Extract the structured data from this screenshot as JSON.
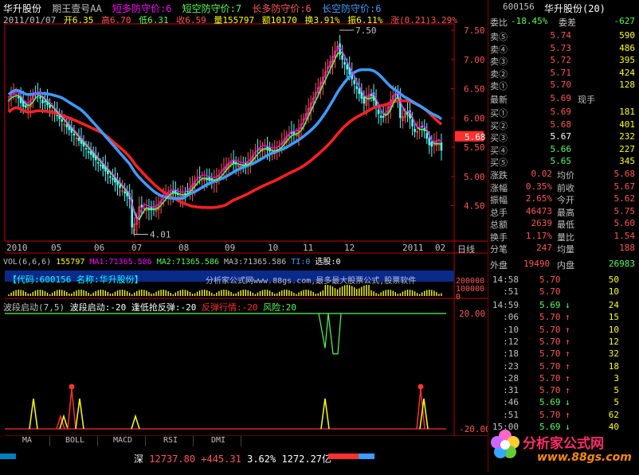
{
  "header": {
    "stock_name": "华升股份",
    "formula": "期王壹号AA",
    "ind1": "短多防守价:6",
    "ind2": "短空防守价:7",
    "ind3": "长多防守价:6",
    "ind4": "长空防守价:6",
    "date": "2011/01/07",
    "open": "开6.35",
    "high": "高6.70",
    "low": "低6.31",
    "close": "收6.59",
    "volume": "量155797",
    "amount": "额10170",
    "turnover": "换3.91%",
    "amplitude": "振6.11%",
    "change": "涨(0.21)3.29%"
  },
  "price_axis": [
    "7.50",
    "7.00",
    "6.50",
    "6.00",
    "5.50",
    "5.00",
    "4.50"
  ],
  "price_marker": "5.68",
  "annot_high": "7.50",
  "annot_low": "4.01",
  "months": [
    "2010",
    "05",
    "06",
    "07",
    "08",
    "09",
    "10",
    "11",
    "12",
    "2011",
    "02"
  ],
  "period": "日线",
  "vol_line": {
    "label": "VOL(6,6,6)",
    "v": "155797",
    "ma1": "MA1:71365.586",
    "ma2": "MA2:71365.586",
    "ma3": "MA3:71365.586",
    "x": "TI:0",
    "pick": "选股:0"
  },
  "vol_axis": [
    "200000",
    "100000",
    "0"
  ],
  "banner": "【代码:600156 名称:华升股份】",
  "watermark": "分析家公式网www.88gs.com,最多最大股票公式,股票软件",
  "ind_line": {
    "l1": "波段启动(7,5)",
    "l2": "波段启动:-20",
    "l3": "逢低抢反弹:-20",
    "l4": "反弹行情:-20",
    "l5": "风险:20"
  },
  "ind_axis": [
    "20.00",
    "-20.00"
  ],
  "tabs": [
    "MA",
    "BOLL",
    "MACD",
    "RSI",
    "DMI"
  ],
  "status": {
    "market": "深",
    "index": "12737.80",
    "chg": "+445.31",
    "pct": "3.62%",
    "amt": "1272.27亿"
  },
  "quote": {
    "code": "600156",
    "name": "华升股份(20)",
    "webi_label": "委比",
    "webi": "-18.45%",
    "weicha_label": "委差",
    "weicha": "-627",
    "asks": [
      {
        "l": "卖⑤",
        "p": "5.74",
        "v": "590"
      },
      {
        "l": "卖④",
        "p": "5.73",
        "v": "486"
      },
      {
        "l": "卖③",
        "p": "5.72",
        "v": "395"
      },
      {
        "l": "卖②",
        "p": "5.71",
        "v": "424"
      },
      {
        "l": "卖①",
        "p": "5.70",
        "v": "128"
      }
    ],
    "last_label": "最新",
    "last": "5.69",
    "cur_label": "现手",
    "bids": [
      {
        "l": "买①",
        "p": "5.69",
        "v": "181"
      },
      {
        "l": "买②",
        "p": "5.68",
        "v": "401"
      },
      {
        "l": "买③",
        "p": "5.67",
        "v": "232"
      },
      {
        "l": "买④",
        "p": "5.66",
        "v": "227"
      },
      {
        "l": "买⑤",
        "p": "5.65",
        "v": "345"
      }
    ],
    "stats": [
      {
        "a": "涨跌",
        "b": "0.02",
        "c": "均价",
        "d": "5.68"
      },
      {
        "a": "涨幅",
        "b": "0.35%",
        "c": "前收",
        "d": "5.67"
      },
      {
        "a": "振幅",
        "b": "2.65%",
        "c": "今开",
        "d": "5.62"
      },
      {
        "a": "总手",
        "b": "46473",
        "c": "最高",
        "d": "5.75"
      },
      {
        "a": "总额",
        "b": "2639",
        "c": "最低",
        "d": "5.60"
      },
      {
        "a": "换手",
        "b": "1.17%",
        "c": "量比",
        "d": "1.54"
      },
      {
        "a": "分笔",
        "b": "247",
        "c": "均量",
        "d": "188"
      }
    ],
    "outer_label": "外盘",
    "outer": "19490",
    "inner_label": "内盘",
    "inner": "26983",
    "ticks": [
      {
        "t": "14:58",
        "p": "5.70",
        "v": "50"
      },
      {
        "t": ":51",
        "p": "5.70",
        "v": "10"
      },
      {
        "t": "14:59",
        "p": "5.69",
        "d": "↓",
        "v": "24"
      },
      {
        "t": ":06",
        "p": "5.70",
        "d": "↑",
        "v": "15"
      },
      {
        "t": ":10",
        "p": "5.70",
        "d": "↑",
        "v": "10"
      },
      {
        "t": ":12",
        "p": "5.70",
        "d": "↑",
        "v": "12"
      },
      {
        "t": ":18",
        "p": "5.70",
        "d": "↑",
        "v": "32"
      },
      {
        "t": ":23",
        "p": "5.70",
        "d": "↑",
        "v": "18"
      },
      {
        "t": ":28",
        "p": "5.70",
        "d": "↑",
        "v": "3"
      },
      {
        "t": ":31",
        "p": "5.70",
        "d": "↑",
        "v": "5"
      },
      {
        "t": ":46",
        "p": "5.69",
        "d": "↓",
        "v": "5"
      },
      {
        "t": ":51",
        "p": "5.70",
        "d": "↑",
        "v": "62"
      },
      {
        "t": "15:00",
        "p": "5.69",
        "d": "↓",
        "v": "40"
      }
    ]
  },
  "logo": {
    "brand": "分析家公式网",
    "url": "www.88gs.com"
  },
  "colors": {
    "red": "#ff3030",
    "green": "#54fc54",
    "up": "#ff5454",
    "yellow": "#ffff00",
    "cyan": "#00ffff",
    "blue": "#3c9cff",
    "magenta": "#ff00ff"
  }
}
